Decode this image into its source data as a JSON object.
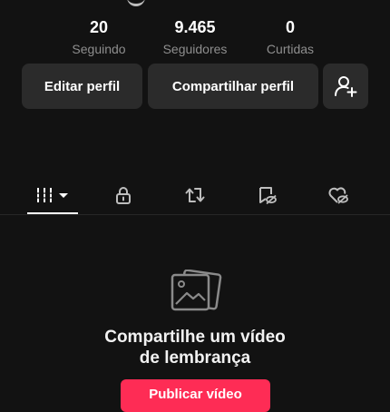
{
  "profile": {
    "stats": [
      {
        "value": "20",
        "label": "Seguindo"
      },
      {
        "value": "9.465",
        "label": "Seguidores"
      },
      {
        "value": "0",
        "label": "Curtidas"
      }
    ],
    "buttons": {
      "edit_profile": "Editar perfil",
      "share_profile": "Compartilhar perfil"
    }
  },
  "tabs": [
    {
      "icon": "videos-grid-icon",
      "selected": true
    },
    {
      "icon": "lock-icon",
      "selected": false
    },
    {
      "icon": "repost-icon",
      "selected": false
    },
    {
      "icon": "bookmark-hidden-icon",
      "selected": false
    },
    {
      "icon": "heart-hidden-icon",
      "selected": false
    }
  ],
  "empty_state": {
    "icon": "photos-icon",
    "title_line1": "Compartilhe um vídeo",
    "title_line2": "de lembrança",
    "cta_label": "Publicar vídeo"
  },
  "colors": {
    "background": "#121212",
    "button_bg": "#2b2b2b",
    "accent": "#fe2c55",
    "muted_text": "#8e8e8e"
  }
}
